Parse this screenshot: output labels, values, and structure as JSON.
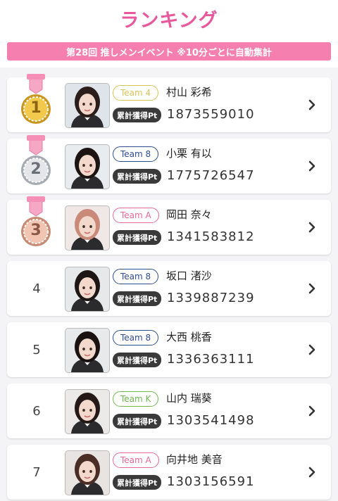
{
  "header": {
    "title": "ランキング"
  },
  "event": {
    "label": "第28回 推しメンイベント ※10分ごとに自動集計"
  },
  "pt_label": "累計獲得Pt",
  "colors": {
    "title": "#e8589b",
    "event_bar": "#f57fae",
    "team_4": "#d9c45a",
    "team_8": "#2f4c8f",
    "team_a": "#e46a95",
    "team_k": "#6fb84e"
  },
  "entries": [
    {
      "rank": "1",
      "medal": "gold-medal-icon",
      "team": "Team 4",
      "team_color": "#d9c45a",
      "name": "村山 彩希",
      "points": "1873559010",
      "photo": {
        "hair": "#2a1d1a",
        "bg": "#dfe4ea"
      }
    },
    {
      "rank": "2",
      "medal": "silver-medal-icon",
      "team": "Team 8",
      "team_color": "#2f4c8f",
      "name": "小栗 有以",
      "points": "1775726547",
      "photo": {
        "hair": "#1c1412",
        "bg": "#e9ecef"
      }
    },
    {
      "rank": "3",
      "medal": "bronze-medal-icon",
      "team": "Team A",
      "team_color": "#e46a95",
      "name": "岡田 奈々",
      "points": "1341583812",
      "photo": {
        "hair": "#c98a7a",
        "bg": "#f0e8e6"
      }
    },
    {
      "rank": "4",
      "team": "Team 8",
      "team_color": "#2f4c8f",
      "name": "坂口 渚沙",
      "points": "1339887239",
      "photo": {
        "hair": "#1e1614",
        "bg": "#e6e8ea"
      }
    },
    {
      "rank": "5",
      "team": "Team 8",
      "team_color": "#2f4c8f",
      "name": "大西 桃香",
      "points": "1336363111",
      "photo": {
        "hair": "#1a1210",
        "bg": "#e8e9eb"
      }
    },
    {
      "rank": "6",
      "team": "Team K",
      "team_color": "#6fb84e",
      "name": "山内 瑞葵",
      "points": "1303541498",
      "photo": {
        "hair": "#241917",
        "bg": "#eceae8"
      }
    },
    {
      "rank": "7",
      "team": "Team A",
      "team_color": "#e46a95",
      "name": "向井地 美音",
      "points": "1303156591",
      "photo": {
        "hair": "#4a2e26",
        "bg": "#e7e4e2"
      }
    }
  ]
}
